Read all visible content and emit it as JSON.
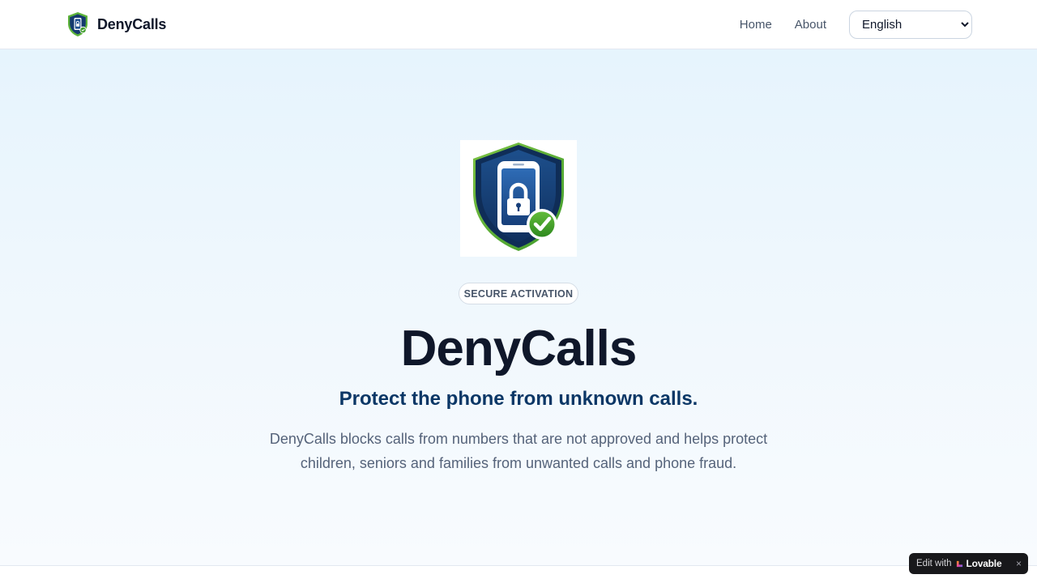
{
  "header": {
    "brand_name": "DenyCalls",
    "brand_icon": "shield-lock-icon",
    "nav": {
      "home_label": "Home",
      "about_label": "About"
    },
    "language": {
      "selected": "English"
    }
  },
  "hero": {
    "logo_icon": "shield-phone-lock-check-icon",
    "badge": "SECURE ACTIVATION",
    "title": "DenyCalls",
    "subtitle": "Protect the phone from unknown calls.",
    "description_line1": "DenyCalls blocks calls from numbers that are not approved and helps protect",
    "description_line2": "children, seniors and families from unwanted calls and phone fraud."
  },
  "lovable": {
    "edit_label": "Edit with",
    "brand": "Lovable",
    "close_glyph": "×"
  },
  "colors": {
    "accent_green": "#5db33a",
    "shield_navy": "#153a6e",
    "subtitle_navy": "#0b3766",
    "title": "#0f172a"
  }
}
